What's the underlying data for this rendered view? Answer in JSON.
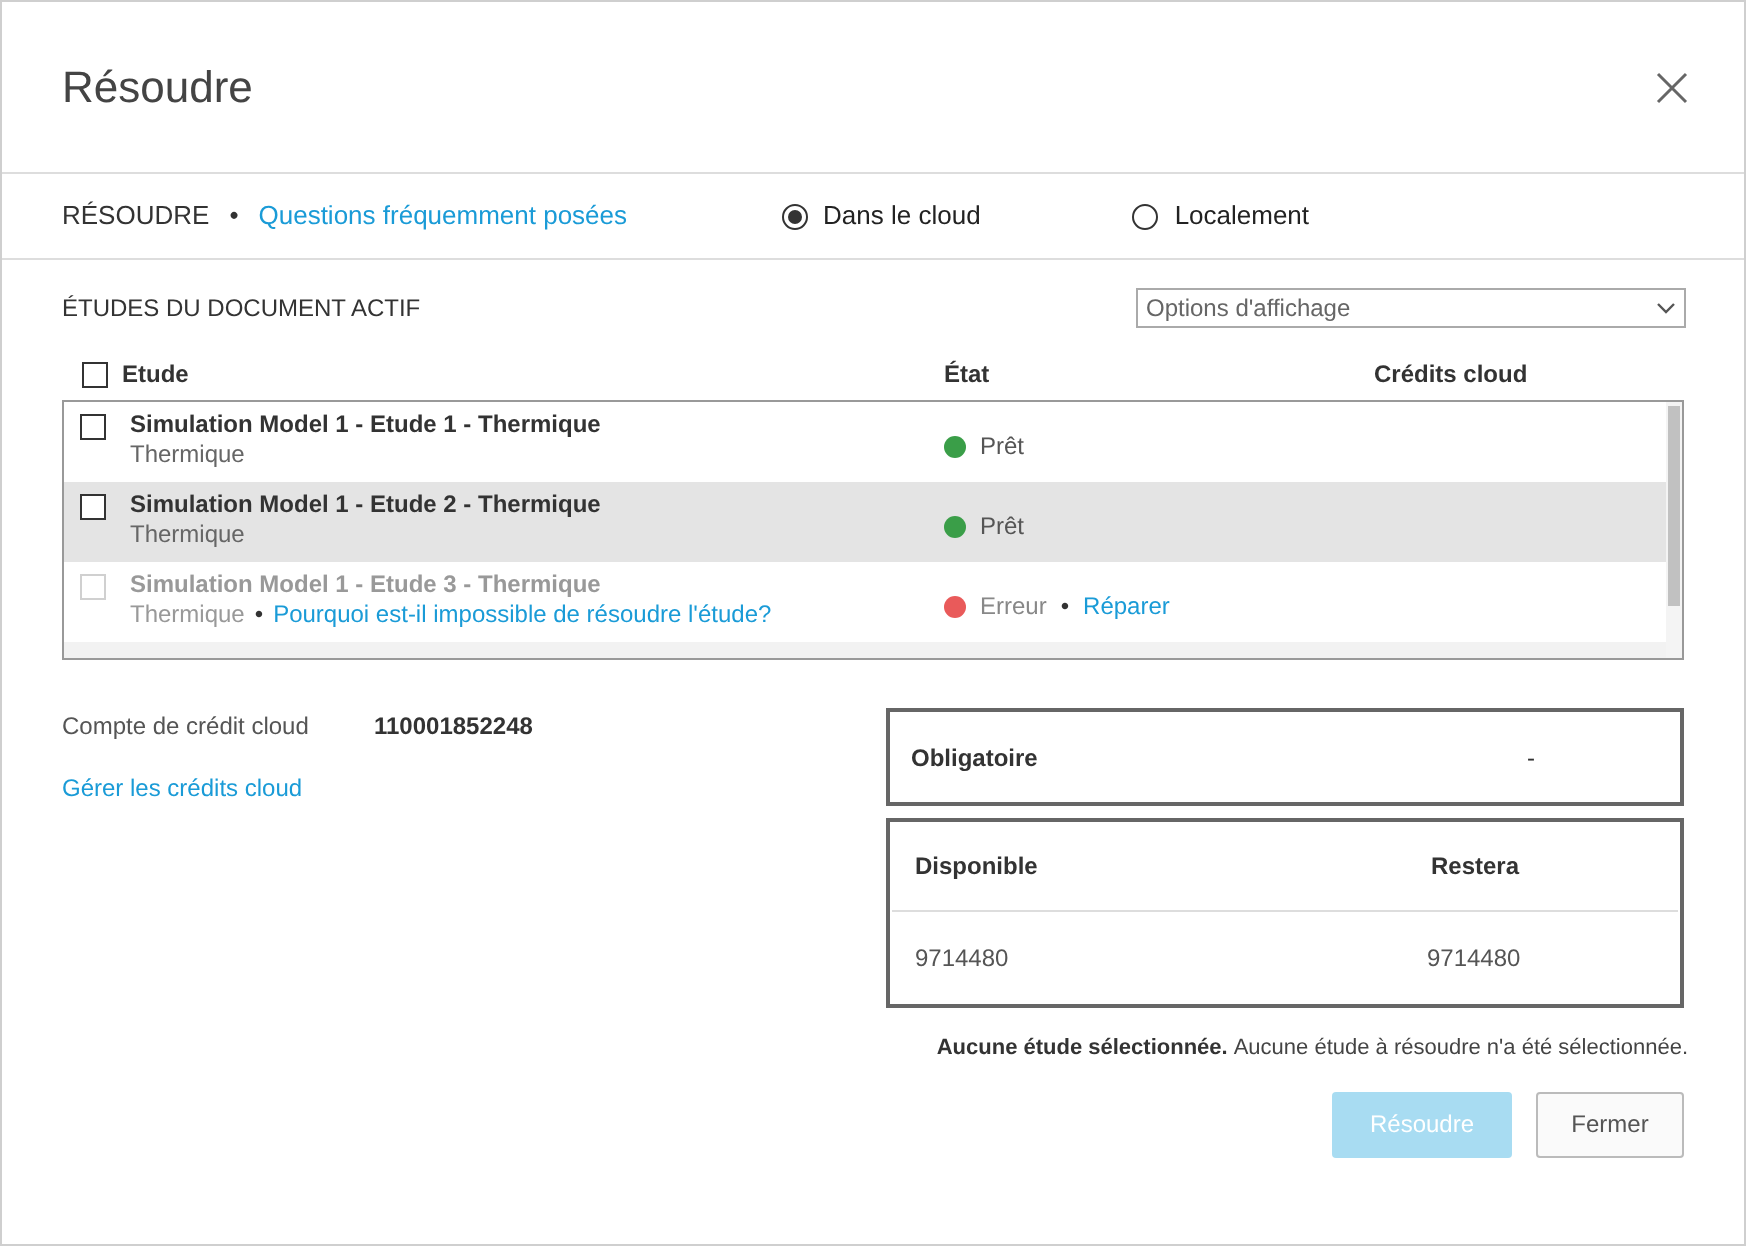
{
  "dialog": {
    "title": "Résoudre"
  },
  "toolbar": {
    "label": "RÉSOUDRE",
    "separator": "•",
    "link": "Questions fréquemment posées",
    "options": [
      {
        "label": "Dans le cloud",
        "selected": true
      },
      {
        "label": "Localement",
        "selected": false
      }
    ]
  },
  "studies": {
    "heading": "ÉTUDES DU DOCUMENT ACTIF",
    "display_options": {
      "placeholder": "Options d'affichage"
    },
    "columns": [
      "Etude",
      "État",
      "Crédits cloud"
    ],
    "select_all": {
      "checked": false
    },
    "rows": [
      {
        "name": "Simulation Model 1 - Etude 1 - Thermique",
        "type": "Thermique",
        "status": "Prêt",
        "color": "#3a9e48",
        "checked": false,
        "disabled": false,
        "highlighted": false
      },
      {
        "name": "Simulation Model 1 - Etude 2 - Thermique",
        "type": "Thermique",
        "status": "Prêt",
        "color": "#3a9e48",
        "checked": false,
        "disabled": false,
        "highlighted": true
      },
      {
        "name": "Simulation Model 1 - Etude 3 - Thermique",
        "type": "Thermique",
        "type_link": "Pourquoi est-il impossible de résoudre l'étude?",
        "status": "Erreur",
        "color": "#e95a5a",
        "status_link": "Réparer",
        "checked": false,
        "disabled": true,
        "highlighted": false
      }
    ]
  },
  "account": {
    "label": "Compte de crédit cloud",
    "value": "110001852248",
    "link": "Gérer les crédits cloud"
  },
  "required": {
    "label": "Obligatoire",
    "value": "-"
  },
  "credits": {
    "columns": [
      "Disponible",
      "Restera"
    ],
    "values": [
      "9714480",
      "9714480"
    ]
  },
  "message": {
    "title": "Aucune étude sélectionnée.",
    "text": "Aucune étude à résoudre n'a été sélectionnée."
  },
  "buttons": [
    {
      "label": "Résoudre",
      "kind": "primary",
      "disabled": true
    },
    {
      "label": "Fermer",
      "kind": "secondary",
      "disabled": false
    }
  ]
}
